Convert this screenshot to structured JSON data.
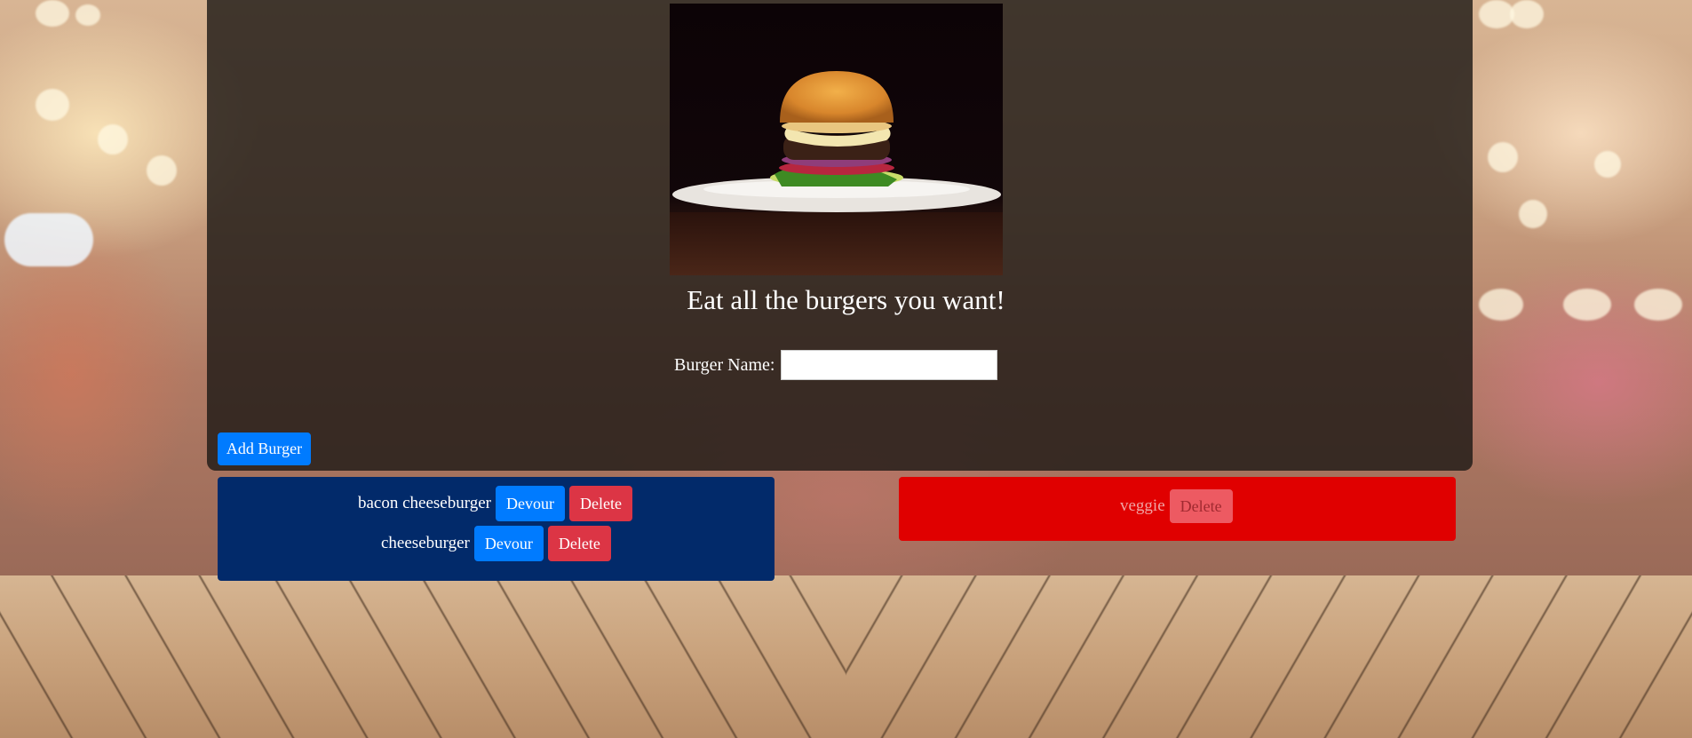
{
  "header": {
    "title": "Eat all the burgers you want!"
  },
  "form": {
    "label": "Burger Name:",
    "input_value": "",
    "submit_label": "Add Burger"
  },
  "uneaten": [
    {
      "name": "bacon cheeseburger",
      "devour_label": "Devour",
      "delete_label": "Delete"
    },
    {
      "name": "cheeseburger",
      "devour_label": "Devour",
      "delete_label": "Delete"
    }
  ],
  "eaten": [
    {
      "name": "veggie",
      "delete_label": "Delete"
    }
  ],
  "colors": {
    "uneaten_panel": "#022a6a",
    "eaten_panel": "#e00000",
    "primary_button": "#007bff",
    "danger_button": "#dc3545"
  },
  "hero_image": "burger-photo"
}
